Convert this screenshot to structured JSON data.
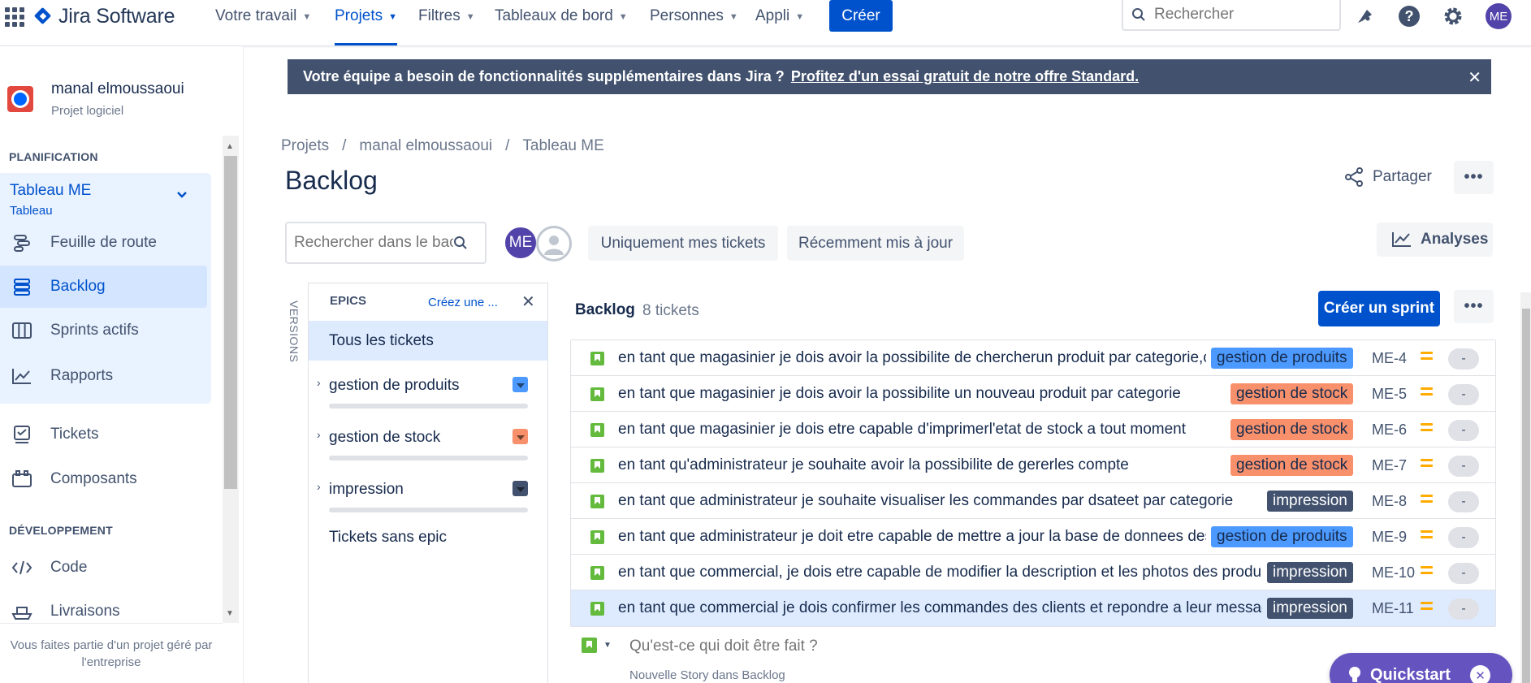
{
  "topnav": {
    "brand": "Jira Software",
    "items": [
      {
        "label": "Votre travail"
      },
      {
        "label": "Projets"
      },
      {
        "label": "Filtres"
      },
      {
        "label": "Tableaux de bord"
      },
      {
        "label": "Personnes"
      },
      {
        "label": "Appli"
      }
    ],
    "create_label": "Créer",
    "search_placeholder": "Rechercher",
    "avatar_initials": "ME"
  },
  "sidebar": {
    "project_name": "manal elmoussaoui",
    "project_type": "Projet logiciel",
    "planning_heading": "PLANIFICATION",
    "board_name": "Tableau ME",
    "board_type": "Tableau",
    "planning_items": [
      {
        "label": "Feuille de route",
        "icon": "roadmap-icon"
      },
      {
        "label": "Backlog",
        "icon": "backlog-icon"
      },
      {
        "label": "Sprints actifs",
        "icon": "board-columns-icon"
      },
      {
        "label": "Rapports",
        "icon": "reports-chart-icon"
      }
    ],
    "other_items": [
      {
        "label": "Tickets",
        "icon": "issues-icon"
      },
      {
        "label": "Composants",
        "icon": "components-icon"
      }
    ],
    "dev_heading": "DÉVELOPPEMENT",
    "dev_items": [
      {
        "label": "Code",
        "icon": "code-icon"
      },
      {
        "label": "Livraisons",
        "icon": "ship-icon"
      }
    ],
    "footer": "Vous faites partie d'un projet géré par l'entreprise"
  },
  "banner": {
    "text": "Votre équipe a besoin de fonctionnalités supplémentaires dans Jira ?",
    "link": "Profitez d'un essai gratuit de notre offre Standard."
  },
  "header": {
    "breadcrumbs": [
      "Projets",
      "/",
      "manal elmoussaoui",
      "/",
      "Tableau ME"
    ],
    "title": "Backlog",
    "share_label": "Partager"
  },
  "filters": {
    "search_placeholder": "Rechercher dans le backlog",
    "avatar_initials": "ME",
    "only_mine": "Uniquement mes tickets",
    "recently_updated": "Récemment mis à jour",
    "insights": "Analyses"
  },
  "epics": {
    "versions_tab": "VERSIONS",
    "heading": "EPICS",
    "create_link": "Créez une ...",
    "all_label": "Tous les tickets",
    "items": [
      {
        "name": "gestion de produits",
        "color": "#4c9aff"
      },
      {
        "name": "gestion de stock",
        "color": "#f79233"
      },
      {
        "name": "impression",
        "color": "#42526e"
      }
    ],
    "no_epic_label": "Tickets sans epic"
  },
  "backlog": {
    "title": "Backlog",
    "count": "8 tickets",
    "create_sprint": "Créer un sprint",
    "issues": [
      {
        "summary": "en tant que magasinier je dois avoir la possibilite de chercherun produit par categorie,c",
        "epic": "gestion de produits",
        "epic_bg": "#4c9aff",
        "epic_fg": "#172b4d",
        "key": "ME-4",
        "estimate": "-"
      },
      {
        "summary": "en tant que magasinier je dois avoir la possibilite un nouveau produit par categorie",
        "epic": "gestion de stock",
        "epic_bg": "#f8906c",
        "epic_fg": "#172b4d",
        "key": "ME-5",
        "estimate": "-"
      },
      {
        "summary": "en tant que magasinier je dois etre capable d'imprimerl'etat de stock a tout moment",
        "epic": "gestion de stock",
        "epic_bg": "#f8906c",
        "epic_fg": "#172b4d",
        "key": "ME-6",
        "estimate": "-"
      },
      {
        "summary": "en tant qu'administrateur je souhaite avoir la possibilite de gererles compte",
        "epic": "gestion de stock",
        "epic_bg": "#f8906c",
        "epic_fg": "#172b4d",
        "key": "ME-7",
        "estimate": "-"
      },
      {
        "summary": "en tant que administrateur je souhaite visualiser les commandes par dsateet par categorie",
        "epic": "impression",
        "epic_bg": "#42526e",
        "epic_fg": "#ffffff",
        "key": "ME-8",
        "estimate": "-"
      },
      {
        "summary": "en tant que administrateur je doit etre capable de mettre a jour la base de donnees des",
        "epic": "gestion de produits",
        "epic_bg": "#4c9aff",
        "epic_fg": "#172b4d",
        "key": "ME-9",
        "estimate": "-"
      },
      {
        "summary": "en tant que commercial, je dois etre capable de modifier la description et les photos des produ",
        "epic": "impression",
        "epic_bg": "#42526e",
        "epic_fg": "#ffffff",
        "key": "ME-10",
        "estimate": "-"
      },
      {
        "summary": "en tant que commercial je dois confirmer les commandes des clients et repondre a leur messag",
        "epic": "impression",
        "epic_bg": "#42526e",
        "epic_fg": "#ffffff",
        "key": "ME-11",
        "estimate": "-"
      }
    ],
    "add_placeholder": "Qu'est-ce qui doit être fait ?",
    "add_hint": "Nouvelle Story dans Backlog"
  },
  "quickstart": {
    "label": "Quickstart"
  }
}
